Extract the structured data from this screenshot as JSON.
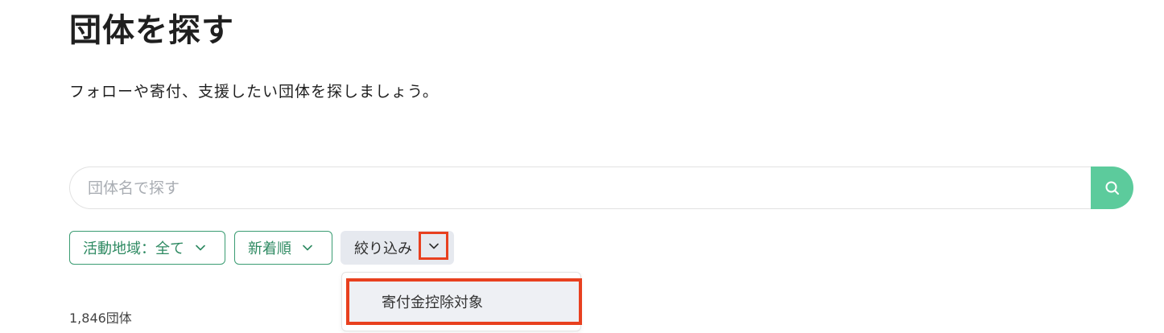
{
  "header": {
    "title": "団体を探す",
    "description": "フォローや寄付、支援したい団体を探しましょう。"
  },
  "search": {
    "placeholder": "団体名で探す",
    "value": "",
    "button_icon": "search-icon",
    "accent_color": "#5ccb9c"
  },
  "filters": {
    "region_label": "活動地域：全て",
    "sort_label": "新着順",
    "narrow_label": "絞り込み",
    "chevron_icon": "chevron-down-icon",
    "pill_color": "#2e8a62"
  },
  "dropdown": {
    "options": [
      {
        "label": "寄付金控除対象"
      }
    ],
    "highlight_color": "#e8401f"
  },
  "results": {
    "count_text": "1,846団体"
  }
}
